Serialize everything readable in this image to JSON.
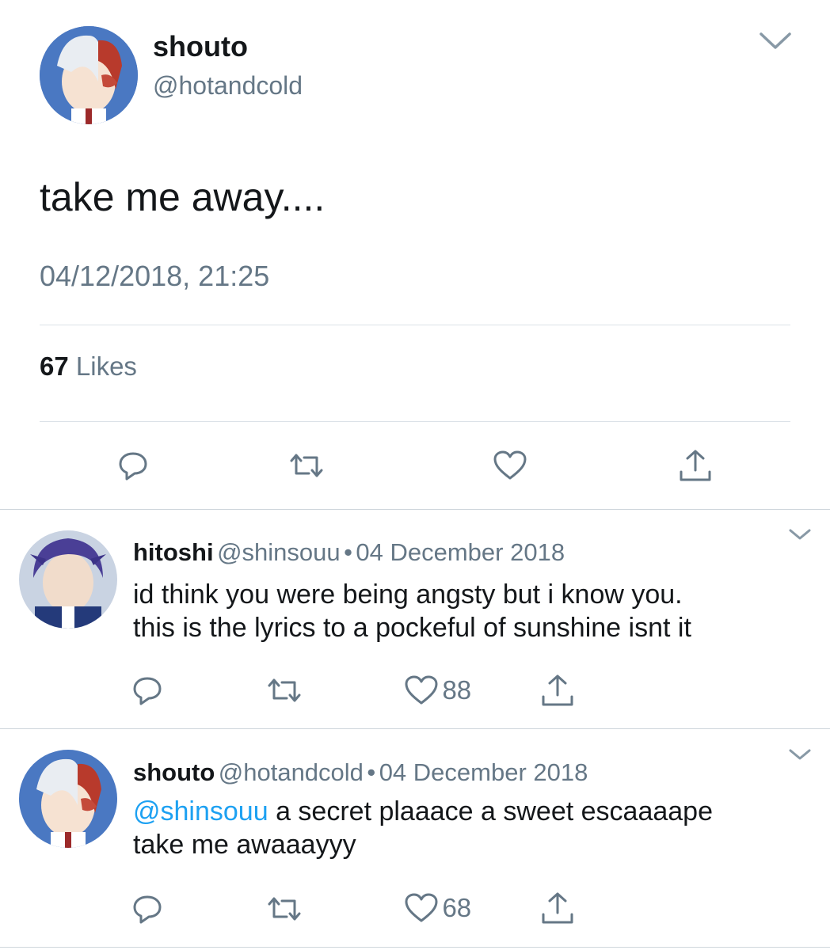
{
  "main_tweet": {
    "display_name": "shouto",
    "handle": "@hotandcold",
    "text": "take me away....",
    "timestamp": "04/12/2018, 21:25",
    "likes_count": "67",
    "likes_label": "Likes"
  },
  "replies": [
    {
      "display_name": "hitoshi",
      "handle": "@shinsouu",
      "separator": "•",
      "date": "04 December 2018",
      "text_lines": [
        "id think you were being angsty but i know you.",
        "this is the lyrics to a pockeful of sunshine isnt it"
      ],
      "likes": "88"
    },
    {
      "display_name": "shouto",
      "handle": "@hotandcold",
      "separator": "•",
      "date": "04 December 2018",
      "mention": "@shinsouu",
      "text_line1_rest": " a secret plaaace a sweet escaaaape",
      "text_line2": "take me awaaayyy",
      "likes": "68"
    }
  ],
  "colors": {
    "text": "#14171a",
    "secondary": "#657786",
    "accent": "#1da1f2",
    "divider": "#dbe2e8"
  }
}
